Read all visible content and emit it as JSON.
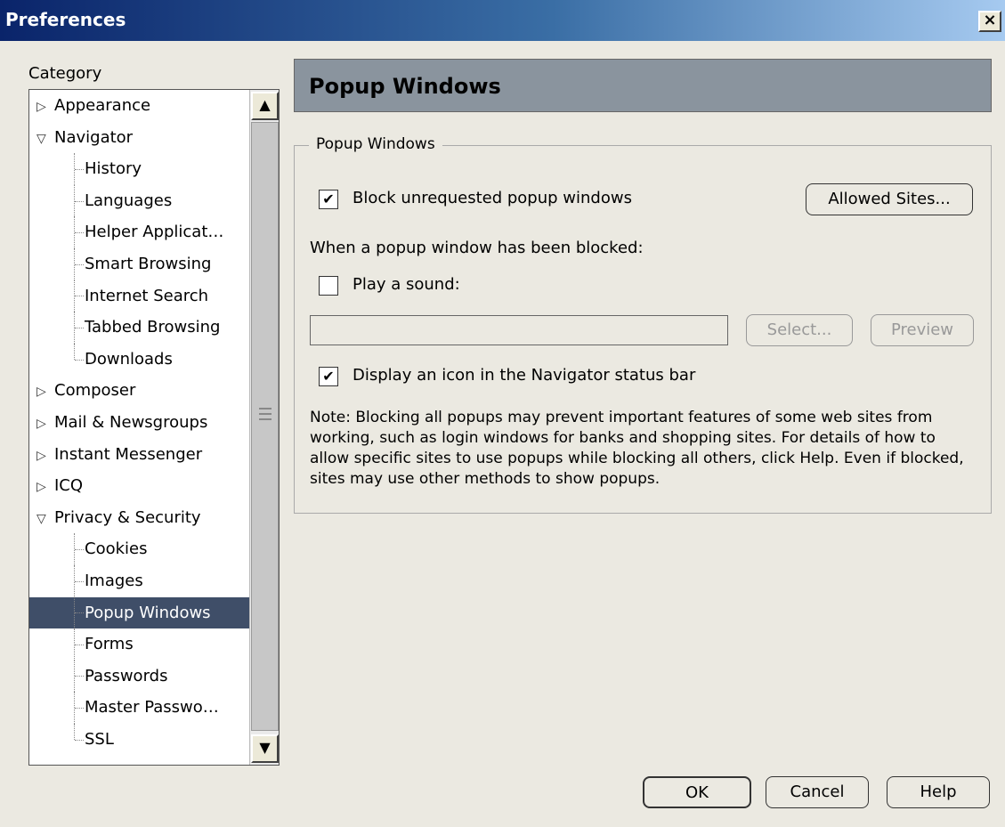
{
  "window": {
    "title": "Preferences",
    "close_icon": "×"
  },
  "sidebar": {
    "category_label": "Category",
    "items": [
      {
        "label": "Appearance",
        "level": 0,
        "state": "collapsed"
      },
      {
        "label": "Navigator",
        "level": 0,
        "state": "expanded"
      },
      {
        "label": "History",
        "level": 1
      },
      {
        "label": "Languages",
        "level": 1
      },
      {
        "label": "Helper Applicat…",
        "level": 1
      },
      {
        "label": "Smart Browsing",
        "level": 1
      },
      {
        "label": "Internet Search",
        "level": 1
      },
      {
        "label": "Tabbed Browsing",
        "level": 1
      },
      {
        "label": "Downloads",
        "level": 1
      },
      {
        "label": "Composer",
        "level": 0,
        "state": "collapsed"
      },
      {
        "label": "Mail & Newsgroups",
        "level": 0,
        "state": "collapsed"
      },
      {
        "label": "Instant Messenger",
        "level": 0,
        "state": "collapsed"
      },
      {
        "label": "ICQ",
        "level": 0,
        "state": "collapsed"
      },
      {
        "label": "Privacy & Security",
        "level": 0,
        "state": "expanded"
      },
      {
        "label": "Cookies",
        "level": 1
      },
      {
        "label": "Images",
        "level": 1
      },
      {
        "label": "Popup Windows",
        "level": 1,
        "selected": true
      },
      {
        "label": "Forms",
        "level": 1
      },
      {
        "label": "Passwords",
        "level": 1
      },
      {
        "label": "Master Passwo…",
        "level": 1
      },
      {
        "label": "SSL",
        "level": 1
      }
    ]
  },
  "panel": {
    "header_title": "Popup Windows",
    "group_title": "Popup Windows",
    "block_popups": {
      "label": "Block unrequested popup windows",
      "checked": true
    },
    "allowed_sites_button": "Allowed Sites...",
    "blocked_heading": "When a popup window has been blocked:",
    "play_sound": {
      "label": "Play a sound:",
      "checked": false
    },
    "sound_path": "",
    "select_button": "Select...",
    "preview_button": "Preview",
    "display_icon": {
      "label": "Display an icon in the Navigator status bar",
      "checked": true
    },
    "note": "Note: Blocking all popups may prevent important features of some web sites from working, such as login windows for banks and shopping sites. For details of how to allow specific sites to use popups while blocking all others, click Help. Even if blocked, sites may use other methods to show popups."
  },
  "footer": {
    "ok_button": "OK",
    "cancel_button": "Cancel",
    "help_button": "Help"
  },
  "colors": {
    "title_gradient_start": "#0a246a",
    "selected_row": "#3f4e68",
    "header_box": "#8a949e",
    "dialog_bg": "#ebe9e1"
  }
}
